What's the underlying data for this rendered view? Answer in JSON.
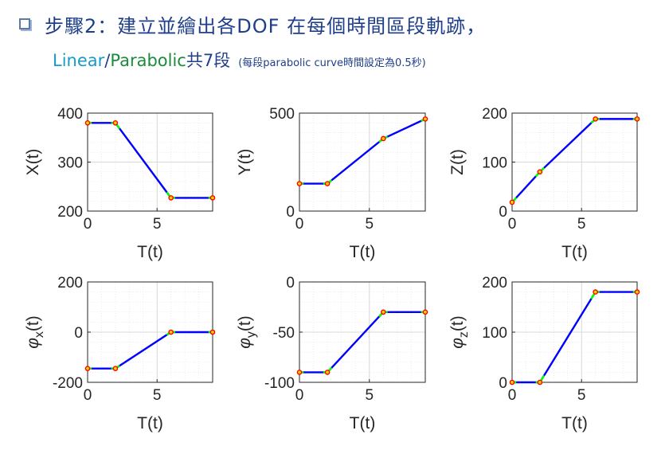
{
  "heading": {
    "bullet": "square-bullet-icon",
    "text": "步驟2：建立並繪出各DOF 在每個時間區段軌跡，"
  },
  "subheading": {
    "linear": "Linear",
    "slash": "/",
    "parabolic": "Parabolic",
    "tail": "共7段",
    "note": "(每段parabolic curve時間設定為0.5秒)"
  },
  "colors": {
    "heading": "#1f3f8a",
    "linear": "#1a9ac9",
    "parabolic": "#1a8c3a",
    "line": "#0000ff",
    "blend": "#00ff00",
    "via_marker": "#ff0000"
  },
  "chart_data": [
    {
      "type": "line",
      "xlabel": "T(t)",
      "ylabel": "X(t)",
      "xlim": [
        0,
        9
      ],
      "ylim": [
        200,
        400
      ],
      "xticks": [
        0,
        5
      ],
      "yticks": [
        200,
        300,
        400
      ],
      "ytick_labels": [
        "200",
        "300",
        "400"
      ],
      "x": [
        0,
        2,
        6,
        9
      ],
      "y": [
        380,
        380,
        227,
        227
      ]
    },
    {
      "type": "line",
      "xlabel": "T(t)",
      "ylabel": "Y(t)",
      "xlim": [
        0,
        9
      ],
      "ylim": [
        0,
        500
      ],
      "xticks": [
        0,
        5
      ],
      "yticks": [
        0,
        500
      ],
      "ytick_labels": [
        "0",
        "500"
      ],
      "x": [
        0,
        2,
        6,
        9
      ],
      "y": [
        140,
        140,
        370,
        470
      ]
    },
    {
      "type": "line",
      "xlabel": "T(t)",
      "ylabel": "Z(t)",
      "xlim": [
        0,
        9
      ],
      "ylim": [
        0,
        200
      ],
      "xticks": [
        0,
        5
      ],
      "yticks": [
        0,
        100,
        200
      ],
      "ytick_labels": [
        "0",
        "100",
        "200"
      ],
      "x": [
        0,
        2,
        6,
        9
      ],
      "y": [
        18,
        80,
        188,
        188
      ]
    },
    {
      "type": "line",
      "xlabel": "T(t)",
      "ylabel": "φx(t)",
      "ylabel_main": "φ",
      "ylabel_sub": "x",
      "ylabel_tail": "(t)",
      "xlim": [
        0,
        9
      ],
      "ylim": [
        -200,
        200
      ],
      "xticks": [
        0,
        5
      ],
      "yticks": [
        -200,
        0,
        200
      ],
      "ytick_labels": [
        "-200",
        "0",
        "200"
      ],
      "x": [
        0,
        2,
        6,
        9
      ],
      "y": [
        -145,
        -145,
        0,
        0
      ]
    },
    {
      "type": "line",
      "xlabel": "T(t)",
      "ylabel": "φy(t)",
      "ylabel_main": "φ",
      "ylabel_sub": "y",
      "ylabel_tail": "(t)",
      "xlim": [
        0,
        9
      ],
      "ylim": [
        -100,
        0
      ],
      "xticks": [
        0,
        5
      ],
      "yticks": [
        -100,
        -50,
        0
      ],
      "ytick_labels": [
        "-100",
        "-50",
        "0"
      ],
      "x": [
        0,
        2,
        6,
        9
      ],
      "y": [
        -90,
        -90,
        -30,
        -30
      ]
    },
    {
      "type": "line",
      "xlabel": "T(t)",
      "ylabel": "φz(t)",
      "ylabel_main": "φ",
      "ylabel_sub": "z",
      "ylabel_tail": "(t)",
      "xlim": [
        0,
        9
      ],
      "ylim": [
        0,
        200
      ],
      "xticks": [
        0,
        5
      ],
      "yticks": [
        0,
        100,
        200
      ],
      "ytick_labels": [
        "0",
        "100",
        "200"
      ],
      "x": [
        0,
        2,
        6,
        9
      ],
      "y": [
        0,
        0,
        180,
        180
      ]
    }
  ]
}
